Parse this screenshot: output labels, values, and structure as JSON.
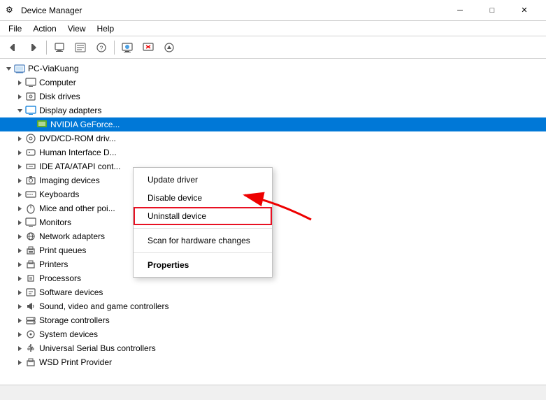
{
  "titlebar": {
    "title": "Device Manager",
    "icon": "⚙",
    "minimize_label": "─",
    "maximize_label": "□",
    "close_label": "✕"
  },
  "menubar": {
    "items": [
      "File",
      "Action",
      "View",
      "Help"
    ]
  },
  "toolbar": {
    "buttons": [
      "◀",
      "▶",
      "🖥",
      "📋",
      "❓",
      "🖥",
      "🗑",
      "⬇"
    ]
  },
  "tree": {
    "items": [
      {
        "id": "root",
        "label": "PC-ViaKuang",
        "indent": 0,
        "expanded": true,
        "icon": "💻",
        "hasExpander": true,
        "expanderState": "▼"
      },
      {
        "id": "computer",
        "label": "Computer",
        "indent": 1,
        "expanded": false,
        "icon": "🖥",
        "hasExpander": true,
        "expanderState": "▶"
      },
      {
        "id": "disk",
        "label": "Disk drives",
        "indent": 1,
        "expanded": false,
        "icon": "💾",
        "hasExpander": true,
        "expanderState": "▶"
      },
      {
        "id": "display",
        "label": "Display adapters",
        "indent": 1,
        "expanded": true,
        "icon": "🖥",
        "hasExpander": true,
        "expanderState": "▼"
      },
      {
        "id": "nvidia",
        "label": "NVIDIA GeForce...",
        "indent": 2,
        "expanded": false,
        "icon": "🖥",
        "hasExpander": false,
        "expanderState": "",
        "selected": true
      },
      {
        "id": "dvd",
        "label": "DVD/CD-ROM driv...",
        "indent": 1,
        "expanded": false,
        "icon": "💿",
        "hasExpander": true,
        "expanderState": "▶"
      },
      {
        "id": "hid",
        "label": "Human Interface D...",
        "indent": 1,
        "expanded": false,
        "icon": "🖱",
        "hasExpander": true,
        "expanderState": "▶"
      },
      {
        "id": "ide",
        "label": "IDE ATA/ATAPI cont...",
        "indent": 1,
        "expanded": false,
        "icon": "🔌",
        "hasExpander": true,
        "expanderState": "▶"
      },
      {
        "id": "imaging",
        "label": "Imaging devices",
        "indent": 1,
        "expanded": false,
        "icon": "📷",
        "hasExpander": true,
        "expanderState": "▶"
      },
      {
        "id": "keyboards",
        "label": "Keyboards",
        "indent": 1,
        "expanded": false,
        "icon": "⌨",
        "hasExpander": true,
        "expanderState": "▶"
      },
      {
        "id": "mice",
        "label": "Mice and other poi...",
        "indent": 1,
        "expanded": false,
        "icon": "🖱",
        "hasExpander": true,
        "expanderState": "▶"
      },
      {
        "id": "monitors",
        "label": "Monitors",
        "indent": 1,
        "expanded": false,
        "icon": "🖥",
        "hasExpander": true,
        "expanderState": "▶"
      },
      {
        "id": "network",
        "label": "Network adapters",
        "indent": 1,
        "expanded": false,
        "icon": "🌐",
        "hasExpander": true,
        "expanderState": "▶"
      },
      {
        "id": "print_q",
        "label": "Print queues",
        "indent": 1,
        "expanded": false,
        "icon": "🖨",
        "hasExpander": true,
        "expanderState": "▶"
      },
      {
        "id": "printers",
        "label": "Printers",
        "indent": 1,
        "expanded": false,
        "icon": "🖨",
        "hasExpander": true,
        "expanderState": "▶"
      },
      {
        "id": "processors",
        "label": "Processors",
        "indent": 1,
        "expanded": false,
        "icon": "⚙",
        "hasExpander": true,
        "expanderState": "▶"
      },
      {
        "id": "software",
        "label": "Software devices",
        "indent": 1,
        "expanded": false,
        "icon": "💾",
        "hasExpander": true,
        "expanderState": "▶"
      },
      {
        "id": "sound",
        "label": "Sound, video and game controllers",
        "indent": 1,
        "expanded": false,
        "icon": "🔊",
        "hasExpander": true,
        "expanderState": "▶"
      },
      {
        "id": "storage",
        "label": "Storage controllers",
        "indent": 1,
        "expanded": false,
        "icon": "💾",
        "hasExpander": true,
        "expanderState": "▶"
      },
      {
        "id": "system",
        "label": "System devices",
        "indent": 1,
        "expanded": false,
        "icon": "⚙",
        "hasExpander": true,
        "expanderState": "▶"
      },
      {
        "id": "usb",
        "label": "Universal Serial Bus controllers",
        "indent": 1,
        "expanded": false,
        "icon": "🔌",
        "hasExpander": true,
        "expanderState": "▶"
      },
      {
        "id": "wsd",
        "label": "WSD Print Provider",
        "indent": 1,
        "expanded": false,
        "icon": "🖨",
        "hasExpander": true,
        "expanderState": "▶"
      }
    ]
  },
  "context_menu": {
    "items": [
      {
        "id": "update_driver",
        "label": "Update driver",
        "type": "normal"
      },
      {
        "id": "disable_device",
        "label": "Disable device",
        "type": "normal"
      },
      {
        "id": "uninstall_device",
        "label": "Uninstall device",
        "type": "highlighted"
      },
      {
        "id": "sep1",
        "type": "separator"
      },
      {
        "id": "scan_hardware",
        "label": "Scan for hardware changes",
        "type": "normal"
      },
      {
        "id": "sep2",
        "type": "separator"
      },
      {
        "id": "properties",
        "label": "Properties",
        "type": "bold"
      }
    ]
  },
  "statusbar": {
    "text": ""
  }
}
